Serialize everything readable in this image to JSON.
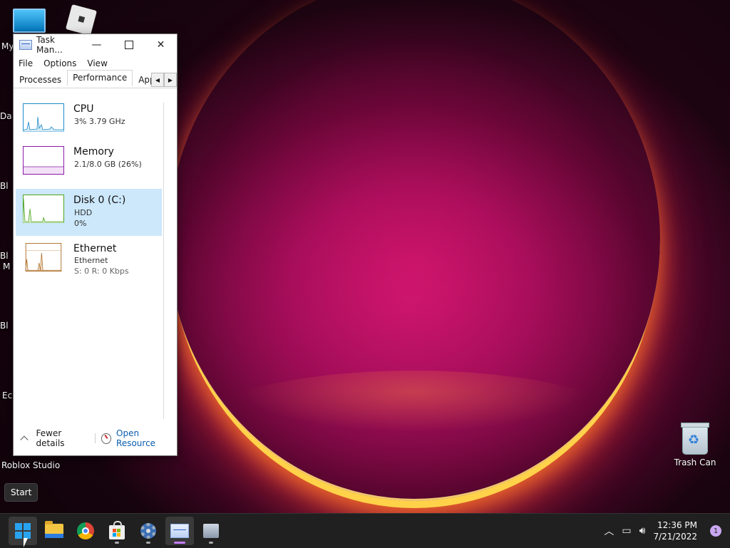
{
  "desktop": {
    "icons": {
      "this_pc_label": "My",
      "roblox_studio_label": "Roblox Studio",
      "trash_label": "Trash Can"
    },
    "partial_labels": [
      "Da",
      "Bl",
      "Bl",
      "M",
      "Bl",
      "Ec"
    ],
    "start_tooltip": "Start"
  },
  "task_manager": {
    "title": "Task Man...",
    "window_buttons": [
      "minimize-icon",
      "maximize-icon",
      "close-icon"
    ],
    "menu": [
      "File",
      "Options",
      "View"
    ],
    "tabs": [
      "Processes",
      "Performance",
      "App his"
    ],
    "active_tab": "Performance",
    "perf_items": [
      {
        "name": "CPU",
        "sub1": "3% 3.79 GHz",
        "sub2": "",
        "color": "#1f8ac9",
        "selected": false
      },
      {
        "name": "Memory",
        "sub1": "2.1/8.0 GB (26%)",
        "sub2": "",
        "color": "#8b1aa8",
        "selected": false
      },
      {
        "name": "Disk 0 (C:)",
        "sub1": "HDD",
        "sub2": "0%",
        "color": "#4da51e",
        "selected": true
      },
      {
        "name": "Ethernet",
        "sub1": "Ethernet",
        "sub2": "S: 0 R: 0 Kbps",
        "color": "#a7651a",
        "selected": false
      }
    ],
    "footer": {
      "fewer_details": "Fewer details",
      "open_resource": "Open Resource"
    }
  },
  "taskbar": {
    "apps": [
      "windows-start-icon",
      "file-explorer-icon",
      "chrome-icon",
      "microsoft-store-icon",
      "settings-icon",
      "task-manager-icon",
      "app-installer-icon"
    ],
    "active_app": "task-manager-icon",
    "clock": {
      "time": "12:36 PM",
      "date": "7/21/2022"
    },
    "notification_count": "1",
    "accent_color": "#c77dff"
  }
}
